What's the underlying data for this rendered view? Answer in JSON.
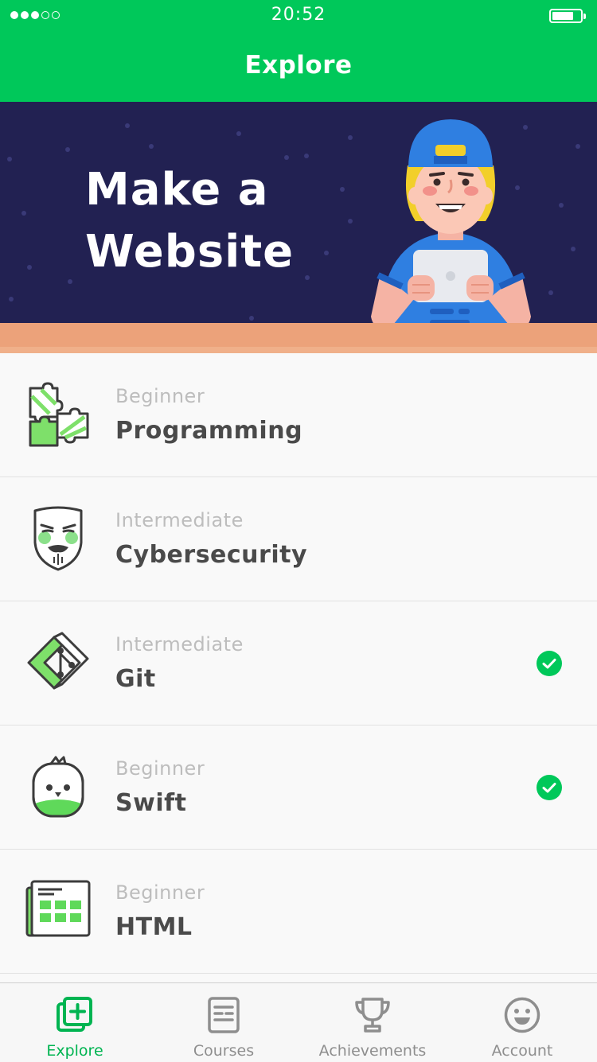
{
  "status_bar": {
    "time": "20:52",
    "signal": "signal-dots",
    "battery": "battery-icon"
  },
  "header": {
    "title": "Explore"
  },
  "hero": {
    "title_line1": "Make a",
    "title_line2": "Website",
    "illustration": "boy-with-tablet"
  },
  "courses": [
    {
      "level": "Beginner",
      "name": "Programming",
      "icon": "puzzle-icon",
      "completed": false
    },
    {
      "level": "Intermediate",
      "name": "Cybersecurity",
      "icon": "mask-icon",
      "completed": false
    },
    {
      "level": "Intermediate",
      "name": "Git",
      "icon": "git-icon",
      "completed": true
    },
    {
      "level": "Beginner",
      "name": "Swift",
      "icon": "swift-bird-icon",
      "completed": true
    },
    {
      "level": "Beginner",
      "name": "HTML",
      "icon": "html-page-icon",
      "completed": false
    }
  ],
  "tabs": [
    {
      "label": "Explore",
      "icon": "explore-icon",
      "active": true
    },
    {
      "label": "Courses",
      "icon": "courses-icon",
      "active": false
    },
    {
      "label": "Achievements",
      "icon": "trophy-icon",
      "active": false
    },
    {
      "label": "Account",
      "icon": "smiley-icon",
      "active": false
    }
  ],
  "colors": {
    "brand": "#00c85a",
    "hero_bg": "#222152",
    "check": "#00c85a",
    "tab_active": "#00b451"
  }
}
